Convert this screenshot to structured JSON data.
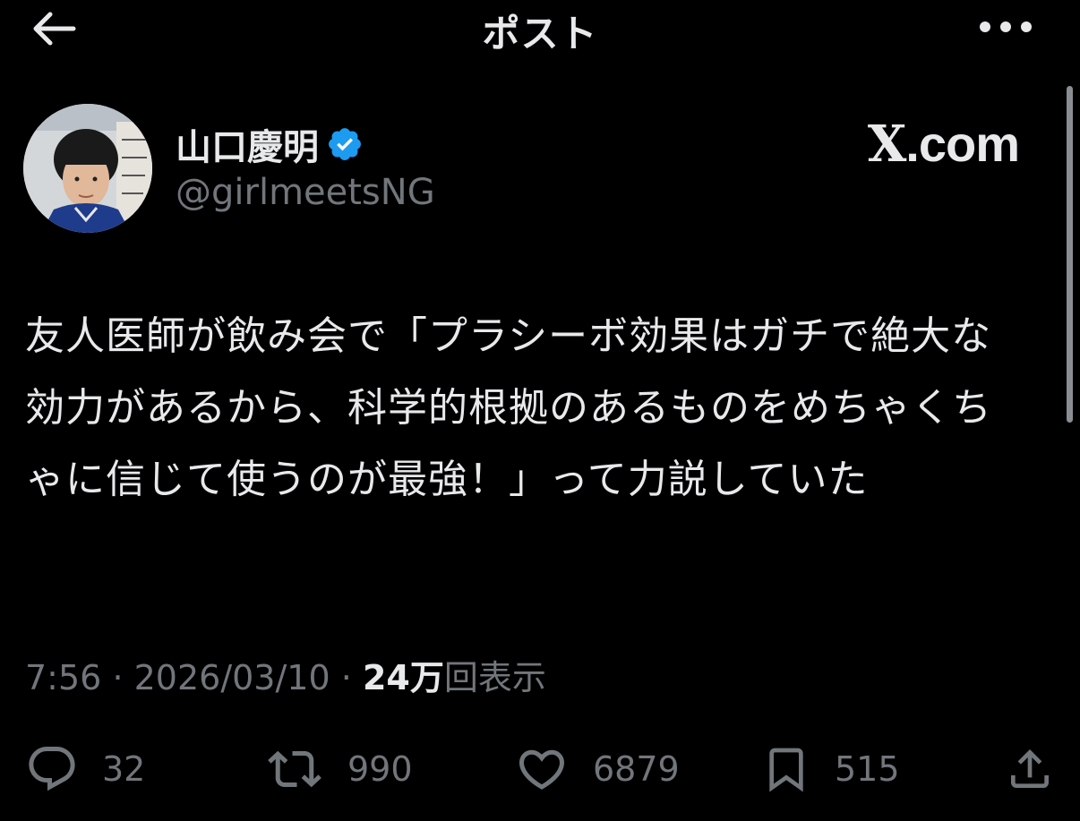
{
  "header": {
    "title": "ポスト"
  },
  "author": {
    "display_name": "山口慶明",
    "handle": "@girlmeetsNG",
    "verified": true
  },
  "brand": {
    "x_glyph": "X",
    "suffix": ".com"
  },
  "tweet": {
    "text": "友人医師が飲み会で「プラシーボ効果はガチで絶大な効力があるから、科学的根拠のあるものをめちゃくちゃに信じて使うのが最強！」って力説していた"
  },
  "meta": {
    "time": "7:56",
    "separator": "·",
    "date": "2026/03/10",
    "views_count": "24万",
    "views_label": "回表示"
  },
  "actions": {
    "replies": "32",
    "reposts": "990",
    "likes": "6879",
    "bookmarks": "515"
  },
  "colors": {
    "background": "#000000",
    "primary_text": "#e7e9ea",
    "secondary_text": "#71767b",
    "verified_blue": "#1d9bf0"
  },
  "icons": [
    "back-arrow-icon",
    "more-icon",
    "verified-badge-icon",
    "reply-icon",
    "repost-icon",
    "like-icon",
    "bookmark-icon",
    "share-icon"
  ]
}
